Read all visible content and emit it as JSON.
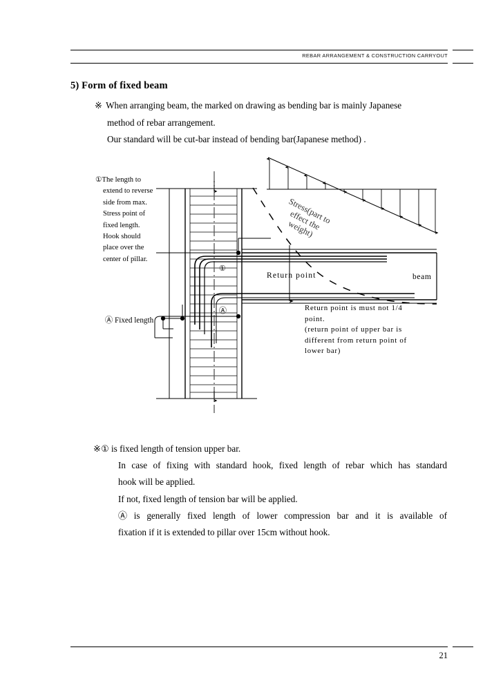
{
  "header": {
    "title": "REBAR ARRANGEMENT & CONSTRUCTION CARRYOUT"
  },
  "footer": {
    "page_number": "21"
  },
  "section": {
    "title": "5) Form of fixed beam"
  },
  "intro": {
    "mark": "※",
    "line1": "When arranging beam,  the marked on drawing as bending bar is mainly Japanese",
    "line2": "method of rebar arrangement.",
    "line3": "Our standard will be cut-bar instead of bending bar(Japanese method) ."
  },
  "left_note": {
    "marker": "①",
    "line1": "The  length  to",
    "line2": "extend to reverse",
    "line3": "side from max.",
    "line4": "Stress  point  of",
    "line5": "fixed     length.",
    "line6": "Hook     should",
    "line7": "place  over  the",
    "line8": "center of pillar."
  },
  "diagram": {
    "stress_label": {
      "line1": "Stress(part to",
      "line2": "effect the",
      "line3": "weight)"
    },
    "return_point_label": "Return point",
    "beam_label": "beam",
    "fixed_length_label": "Ⓐ Fixed length",
    "badge_upper": "①",
    "badge_lower": "Ⓐ",
    "right_note": {
      "line1": "Return point is must not 1/4",
      "line2": "point.",
      "line3": "(return point of upper bar is",
      "line4": "different from return point of",
      "line5": "lower bar)"
    }
  },
  "outro": {
    "mark": "※",
    "marker_upper": "①",
    "marker_lower": "Ⓐ",
    "line1_rest": " is fixed length of tension upper bar.",
    "line2": "In case of fixing with standard hook, fixed length of rebar which has standard",
    "line3": "hook will be applied.",
    "line4": "If not, fixed length of tension bar will be applied.",
    "line5_rest": " is generally fixed length of lower compression bar and it is available of",
    "line6": "fixation if it is extended to pillar over 15cm without hook."
  },
  "colors": {
    "ink": "#000000",
    "rule": "#000000",
    "light_line": "#444444"
  }
}
